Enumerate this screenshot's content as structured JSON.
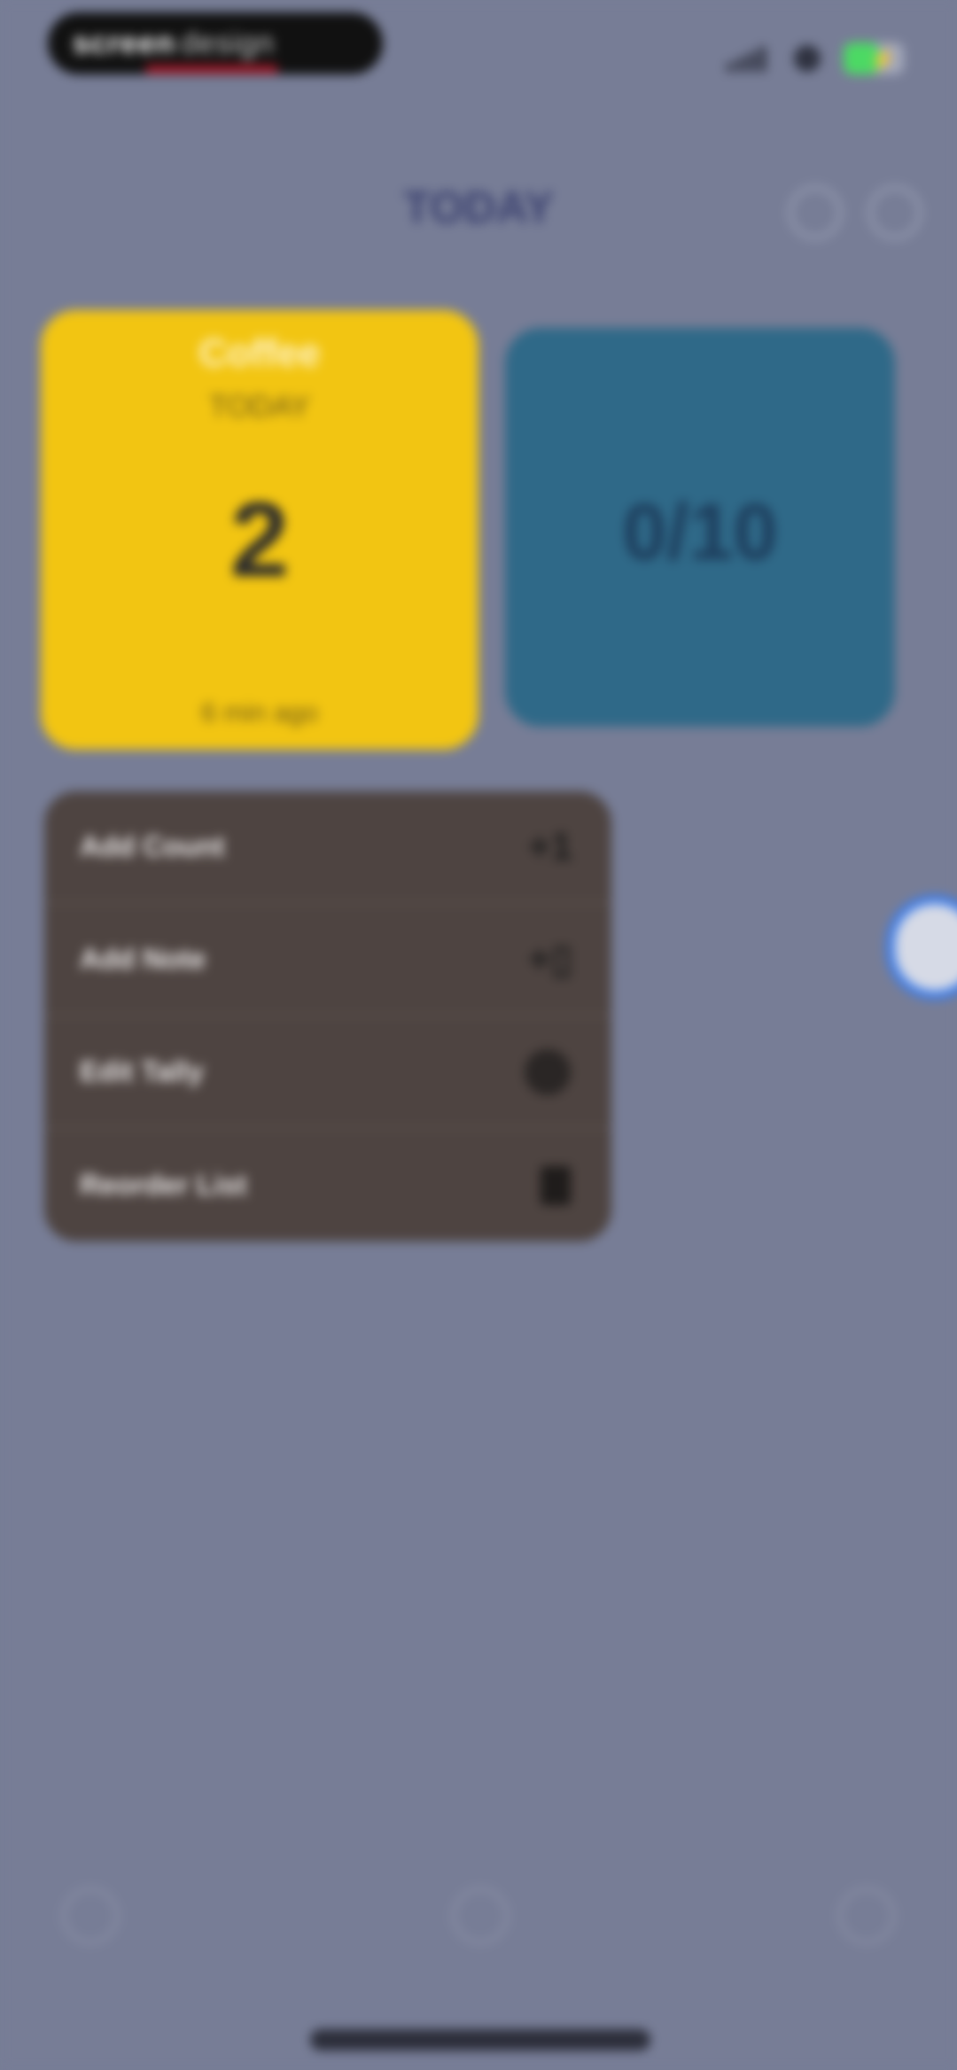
{
  "status_bar": {
    "recorder_label": "screen",
    "recorder_sub": "design",
    "accent_color": "#c0182a",
    "battery_color": "#4cd964",
    "icons": [
      "signal-icon",
      "wifi-icon",
      "battery-icon"
    ]
  },
  "header": {
    "title": "TODAY",
    "icons": [
      "search-icon",
      "settings-icon"
    ]
  },
  "cards": [
    {
      "name": "Coffee",
      "period": "TODAY",
      "count": "2",
      "ago": "6 min ago",
      "color": "#f2c512"
    },
    {
      "name": "",
      "period": "",
      "count": "0/10",
      "ago": "",
      "color": "#2f6988"
    }
  ],
  "menu": {
    "items": [
      {
        "label": "Add Count",
        "icon": "plus-one-icon"
      },
      {
        "label": "Add Note",
        "icon": "add-note-icon"
      },
      {
        "label": "Edit Tally",
        "icon": "edit-icon"
      },
      {
        "label": "Reorder List",
        "icon": "trash-icon"
      }
    ]
  },
  "bottom_bar": {
    "icons": [
      "left-nav-icon",
      "center-nav-icon",
      "right-nav-icon"
    ]
  }
}
